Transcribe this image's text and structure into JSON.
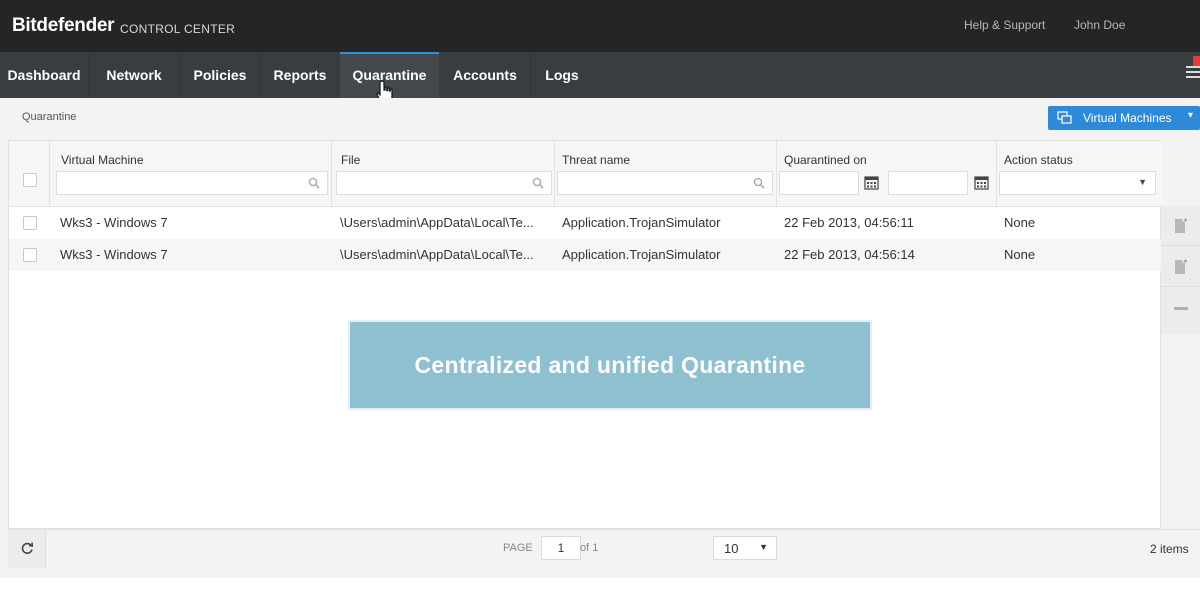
{
  "header": {
    "brand": "Bitdefender",
    "brand_sub": "CONTROL CENTER",
    "help": "Help & Support",
    "user": "John Doe"
  },
  "nav": {
    "items": [
      {
        "label": "Dashboard"
      },
      {
        "label": "Network"
      },
      {
        "label": "Policies"
      },
      {
        "label": "Reports"
      },
      {
        "label": "Quarantine"
      },
      {
        "label": "Accounts"
      },
      {
        "label": "Logs"
      }
    ],
    "active": "Quarantine"
  },
  "breadcrumb": "Quarantine",
  "vm_button": {
    "label": "Virtual Machines"
  },
  "table": {
    "columns": [
      "Virtual Machine",
      "File",
      "Threat name",
      "Quarantined on",
      "Action status"
    ],
    "rows": [
      {
        "vm": "Wks3 - Windows 7",
        "file": "\\Users\\admin\\AppData\\Local\\Te...",
        "threat": "Application.TrojanSimulator",
        "date": "22 Feb 2013, 04:56:11",
        "status": "None"
      },
      {
        "vm": "Wks3 - Windows 7",
        "file": "\\Users\\admin\\AppData\\Local\\Te...",
        "threat": "Application.TrojanSimulator",
        "date": "22 Feb 2013, 04:56:14",
        "status": "None"
      }
    ]
  },
  "banner": "Centralized and unified Quarantine",
  "footer": {
    "page_label": "PAGE",
    "page": "1",
    "of_label": "of 1",
    "per_page": "10",
    "items": "2 items"
  },
  "colors": {
    "accent": "#2e8ad6",
    "topbar": "#232527",
    "navbar": "#3a3d40",
    "banner": "#8fc0d0"
  },
  "icons": [
    "search-icon",
    "calendar-icon",
    "refresh-icon",
    "menu-icon",
    "windows-stack-icon",
    "hand-cursor-icon",
    "restore-file-icon",
    "remove-icon"
  ]
}
